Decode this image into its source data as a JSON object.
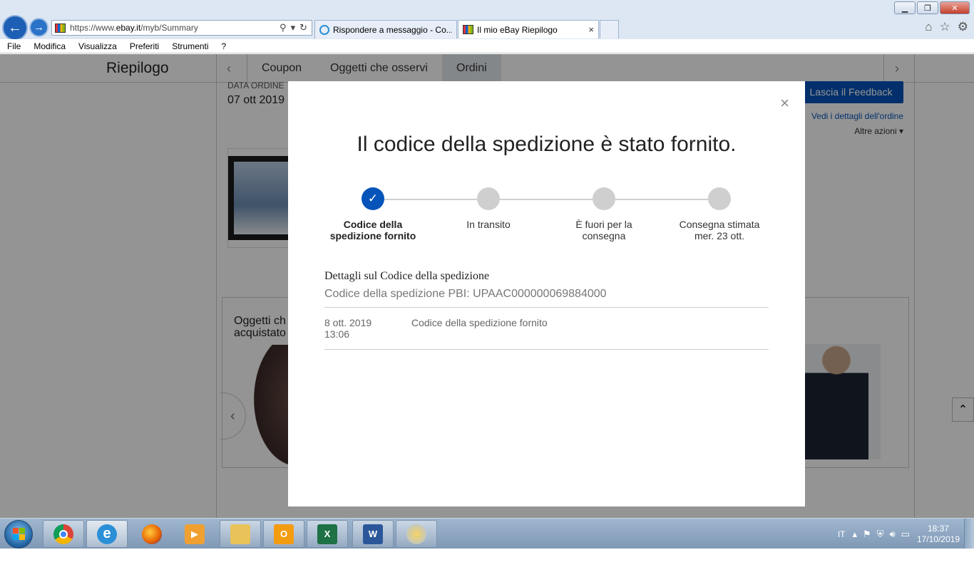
{
  "browser": {
    "url_prefix": "https://www.",
    "url_host": "ebay.it",
    "url_path": "/myb/Summary",
    "tabs": [
      {
        "label": "Rispondere a messaggio - Co..."
      },
      {
        "label": "Il mio eBay Riepilogo",
        "close": "×"
      }
    ],
    "window_buttons": {
      "minimize": "▁",
      "restore": "❐",
      "close": "✕"
    }
  },
  "menubar": [
    "File",
    "Modifica",
    "Visualizza",
    "Preferiti",
    "Strumenti",
    "?"
  ],
  "subnav": {
    "title": "Riepilogo",
    "prev": "‹",
    "next": "›",
    "tabs": [
      "Coupon",
      "Oggetti che osservi",
      "Ordini"
    ],
    "active_tab": "Ordini"
  },
  "order": {
    "date_label": "DATA ORDINE",
    "date": "07 ott 2019",
    "feedback_button": "Lascia il Feedback",
    "details_link": "Vedi i dettagli dell'ordine",
    "more_actions": "Altre azioni"
  },
  "recommendations": {
    "title_line1": "Oggetti ch",
    "title_line2": "acquistato",
    "prev": "‹"
  },
  "modal": {
    "close": "×",
    "title": "Il codice della spedizione è stato fornito.",
    "steps": [
      {
        "line1": "Codice della",
        "line2": "spedizione fornito",
        "done": true
      },
      {
        "line1": "In transito",
        "line2": "",
        "done": false
      },
      {
        "line1": "È fuori per la",
        "line2": "consegna",
        "done": false
      },
      {
        "line1": "Consegna stimata",
        "line2": "mer. 23 ott.",
        "done": false
      }
    ],
    "check": "✓",
    "details_title": "Dettagli sul Codice della spedizione",
    "tracking_code": "Codice della spedizione PBI: UPAAC000000069884000",
    "event": {
      "date": "8 ott. 2019",
      "time": "13:06",
      "description": "Codice della spedizione fornito"
    }
  },
  "taskbar": {
    "language": "IT",
    "time": "18:37",
    "date": "17/10/2019"
  },
  "colors": {
    "ebay_blue": "#0654ba",
    "step_inactive": "#cfcfcf"
  }
}
